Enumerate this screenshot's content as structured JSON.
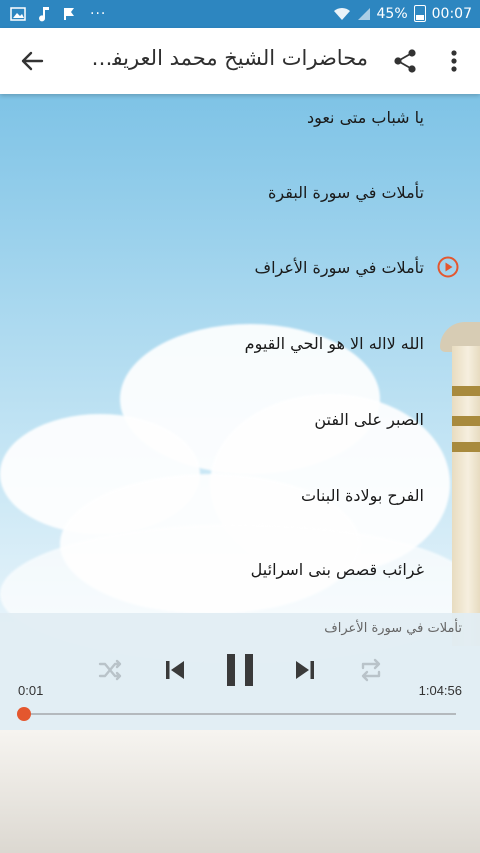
{
  "status_bar": {
    "battery": "45%",
    "time": "00:07",
    "left_icons": [
      "image-icon",
      "music-note-icon",
      "flag-icon"
    ],
    "more": "···"
  },
  "toolbar": {
    "title": "محاضرات الشيخ محمد العريفي ...",
    "icons": [
      "back-arrow-icon",
      "share-icon",
      "more-vert-icon"
    ]
  },
  "list": {
    "items": [
      {
        "label": "يا شباب متى نعود",
        "playing": false
      },
      {
        "label": "تأملات في سورة البقرة",
        "playing": false
      },
      {
        "label": "تأملات في سورة الأعراف",
        "playing": true
      },
      {
        "label": "الله لااله الا هو الحي القيوم",
        "playing": false
      },
      {
        "label": "الصبر على الفتن",
        "playing": false
      },
      {
        "label": "الفرح بولادة البنات",
        "playing": false
      },
      {
        "label": "غرائب قصص بنى اسرائيل",
        "playing": false
      }
    ]
  },
  "player": {
    "now_playing": "تأملات في سورة الأعراف",
    "current_time": "0:01",
    "total_time": "1:04:56",
    "progress": 0.0,
    "controls": [
      "shuffle-icon",
      "previous-icon",
      "pause-icon",
      "next-icon",
      "repeat-icon"
    ]
  },
  "colors": {
    "accent": "#e4572e",
    "status_bar": "#2d86c0",
    "toolbar": "#ffffff"
  }
}
